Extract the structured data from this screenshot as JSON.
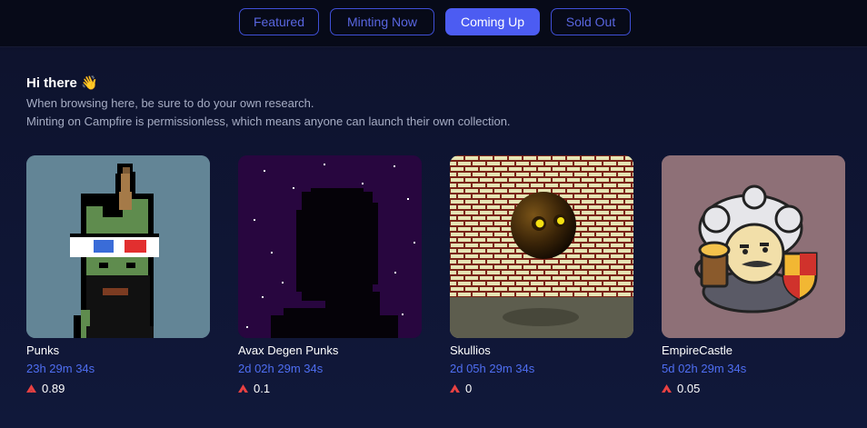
{
  "tabs": [
    {
      "label": "Featured",
      "active": false
    },
    {
      "label": "Minting Now",
      "active": false
    },
    {
      "label": "Coming Up",
      "active": true
    },
    {
      "label": "Sold Out",
      "active": false
    }
  ],
  "intro": {
    "greeting": "Hi there",
    "wave": "👋",
    "line1": "When browsing here, be sure to do your own research.",
    "line2": "Minting on Campfire is permissionless, which means anyone can launch their own collection."
  },
  "collections": [
    {
      "name": "Punks",
      "countdown": " 23h 29m 34s",
      "price": "0.89",
      "currency_icon": "avax-icon"
    },
    {
      "name": "Avax Degen Punks",
      "countdown": "2d 02h 29m 34s",
      "price": "0.1",
      "currency_icon": "avax-icon"
    },
    {
      "name": "Skullios",
      "countdown": "2d 05h 29m 34s",
      "price": "0",
      "currency_icon": "avax-icon"
    },
    {
      "name": "EmpireCastle",
      "countdown": "5d 02h 29m 34s",
      "price": "0.05",
      "currency_icon": "avax-icon"
    }
  ],
  "colors": {
    "accent": "#4c5cf2",
    "countdown": "#4f6ef2",
    "avax_red": "#e84142"
  }
}
